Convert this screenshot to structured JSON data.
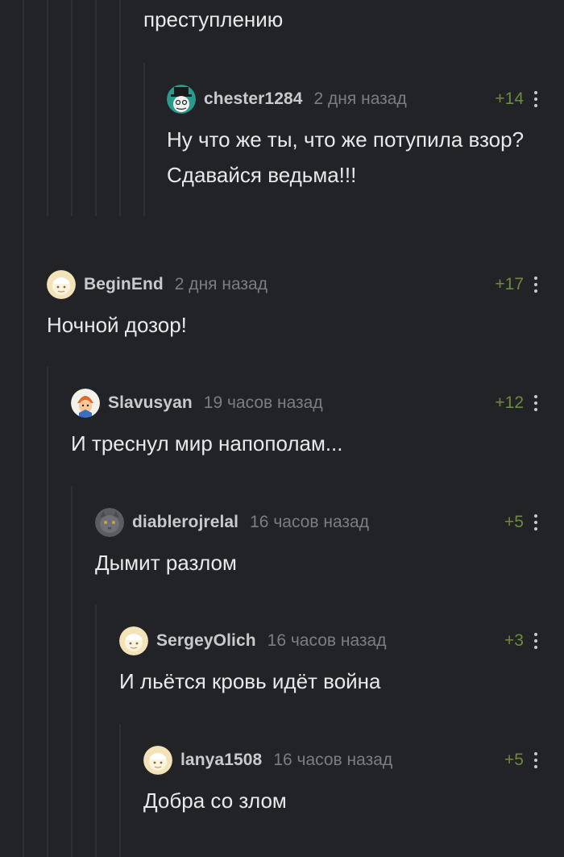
{
  "colors": {
    "background": "#222326",
    "thread_line": "#2f3034",
    "rating_positive": "#6d8a3e",
    "author": "#c9cacc",
    "time": "#7c7d80",
    "text": "#e8e9ea"
  },
  "comments": [
    {
      "id": "c0",
      "text": "преступлению"
    },
    {
      "id": "c1",
      "author": "chester1284",
      "time": "2 дня назад",
      "rating": "+14",
      "avatar_icon": "top-hat-face-avatar",
      "text": "Ну что же ты, что же потупила взор? Сдавайся ведьма!!!"
    },
    {
      "id": "c2",
      "author": "BeginEnd",
      "time": "2 дня назад",
      "rating": "+17",
      "avatar_icon": "default-avatar",
      "text": "Ночной дозор!"
    },
    {
      "id": "c3",
      "author": "Slavusyan",
      "time": "19 часов назад",
      "rating": "+12",
      "avatar_icon": "cartoon-character-avatar",
      "text": "И треснул мир напополам..."
    },
    {
      "id": "c4",
      "author": "diablerojrelal",
      "time": "16 часов назад",
      "rating": "+5",
      "avatar_icon": "cat-avatar",
      "text": "Дымит разлом"
    },
    {
      "id": "c5",
      "author": "SergeyOlich",
      "time": "16 часов назад",
      "rating": "+3",
      "avatar_icon": "default-avatar",
      "text": "И льётся кровь идёт война"
    },
    {
      "id": "c6",
      "author": "lanya1508",
      "time": "16 часов назад",
      "rating": "+5",
      "avatar_icon": "default-avatar",
      "text": "Добра со злом"
    }
  ]
}
